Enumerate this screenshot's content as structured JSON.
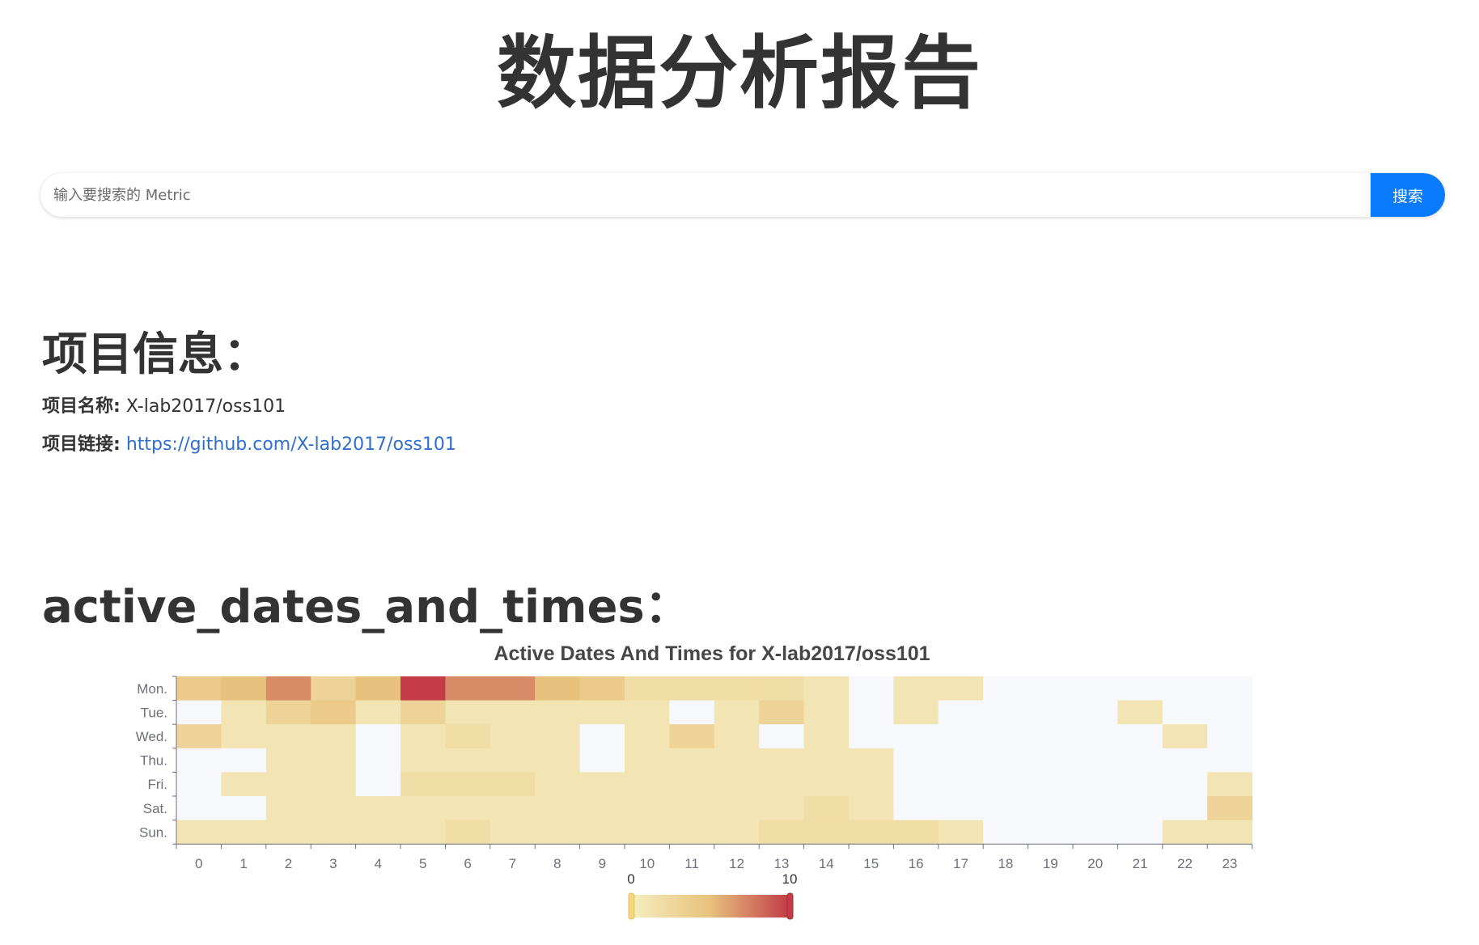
{
  "page": {
    "title": "数据分析报告"
  },
  "search": {
    "placeholder": "输入要搜索的 Metric",
    "button_label": "搜索"
  },
  "project": {
    "heading": "项目信息：",
    "name_label": "项目名称:",
    "name_value": "X-lab2017/oss101",
    "link_label": "项目链接:",
    "link_value": "https://github.com/X-lab2017/oss101"
  },
  "metric_section": {
    "heading": "active_dates_and_times："
  },
  "colors": {
    "heat_low": "#f5eec0",
    "heat_mid": "#e8c17d",
    "heat_high": "#c23b47",
    "empty_cell": "#f7f8fc",
    "search_button": "#0a7bff",
    "link": "#2f6fcf"
  },
  "chart_data": {
    "type": "heatmap",
    "title": "Active Dates And Times for X-lab2017/oss101",
    "y_categories": [
      "Mon.",
      "Tue.",
      "Wed.",
      "Thu.",
      "Fri.",
      "Sat.",
      "Sun."
    ],
    "x_categories": [
      "0",
      "1",
      "2",
      "3",
      "4",
      "5",
      "6",
      "7",
      "8",
      "9",
      "10",
      "11",
      "12",
      "13",
      "14",
      "15",
      "16",
      "17",
      "18",
      "19",
      "20",
      "21",
      "22",
      "23"
    ],
    "values": [
      [
        4,
        5,
        7,
        3,
        5,
        10,
        7,
        7,
        5,
        4,
        2,
        2,
        2,
        2,
        1,
        0,
        1,
        1,
        0,
        0,
        0,
        0,
        0,
        0
      ],
      [
        0,
        1,
        3,
        4,
        1,
        3,
        1,
        1,
        1,
        1,
        1,
        0,
        1,
        3,
        1,
        0,
        1,
        0,
        0,
        0,
        0,
        1,
        0,
        0
      ],
      [
        3,
        1,
        1,
        1,
        0,
        1,
        2,
        1,
        1,
        0,
        1,
        3,
        1,
        0,
        1,
        0,
        0,
        0,
        0,
        0,
        0,
        0,
        1,
        0
      ],
      [
        0,
        0,
        1,
        1,
        0,
        1,
        1,
        1,
        1,
        0,
        1,
        1,
        1,
        1,
        1,
        1,
        0,
        0,
        0,
        0,
        0,
        0,
        0,
        0
      ],
      [
        0,
        1,
        1,
        1,
        0,
        2,
        2,
        2,
        1,
        1,
        1,
        1,
        1,
        1,
        1,
        1,
        0,
        0,
        0,
        0,
        0,
        0,
        0,
        1
      ],
      [
        0,
        0,
        1,
        1,
        1,
        1,
        1,
        1,
        1,
        1,
        1,
        1,
        1,
        1,
        2,
        1,
        0,
        0,
        0,
        0,
        0,
        0,
        0,
        3
      ],
      [
        1,
        1,
        1,
        1,
        1,
        1,
        2,
        1,
        1,
        1,
        1,
        1,
        1,
        2,
        2,
        2,
        2,
        1,
        0,
        0,
        0,
        0,
        1,
        1
      ]
    ],
    "visual_map": {
      "min": 0,
      "max": 10,
      "min_label": "0",
      "max_label": "10"
    },
    "legend": "bottom-center"
  }
}
